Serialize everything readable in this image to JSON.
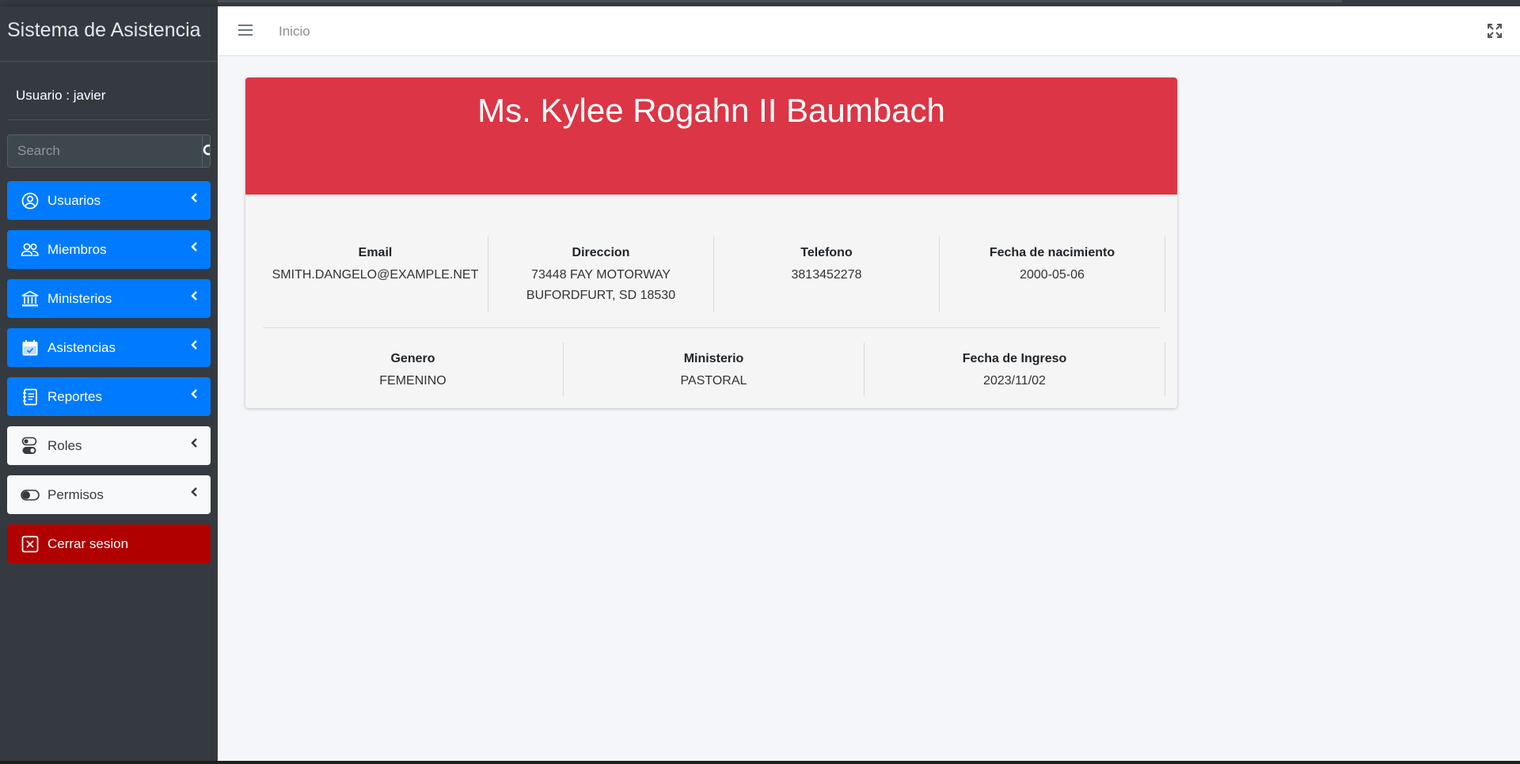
{
  "app": {
    "brand": "Sistema de Asistencia"
  },
  "user": {
    "label": "Usuario : javier"
  },
  "search": {
    "placeholder": "Search"
  },
  "nav": {
    "usuarios": "Usuarios",
    "miembros": "Miembros",
    "ministerios": "Ministerios",
    "asistencias": "Asistencias",
    "reportes": "Reportes",
    "roles": "Roles",
    "permisos": "Permisos",
    "logout": "Cerrar sesion"
  },
  "topbar": {
    "home": "Inicio"
  },
  "profile": {
    "name": "Ms. Kylee Rogahn II Baumbach",
    "email_label": "Email",
    "email": "SMITH.DANGELO@EXAMPLE.NET",
    "address_label": "Direccion",
    "address_line1": "73448 FAY MOTORWAY",
    "address_line2": "BUFORDFURT, SD 18530",
    "phone_label": "Telefono",
    "phone": "3813452278",
    "birth_label": "Fecha de nacimiento",
    "birth": "2000-05-06",
    "gender_label": "Genero",
    "gender": "FEMENINO",
    "ministry_label": "Ministerio",
    "ministry": "PASTORAL",
    "joined_label": "Fecha de Ingreso",
    "joined": "2023/11/02"
  },
  "colors": {
    "primary": "#007bff",
    "header": "#dc3545",
    "danger": "#b00000",
    "sidebar": "#343a40"
  },
  "icons": {
    "usuarios": "user-circle-icon",
    "miembros": "users-icon",
    "ministerios": "bank-icon",
    "asistencias": "calendar-check-icon",
    "reportes": "journal-icon",
    "roles": "toggles-icon",
    "permisos": "toggle-on-icon",
    "logout": "x-square-icon"
  }
}
